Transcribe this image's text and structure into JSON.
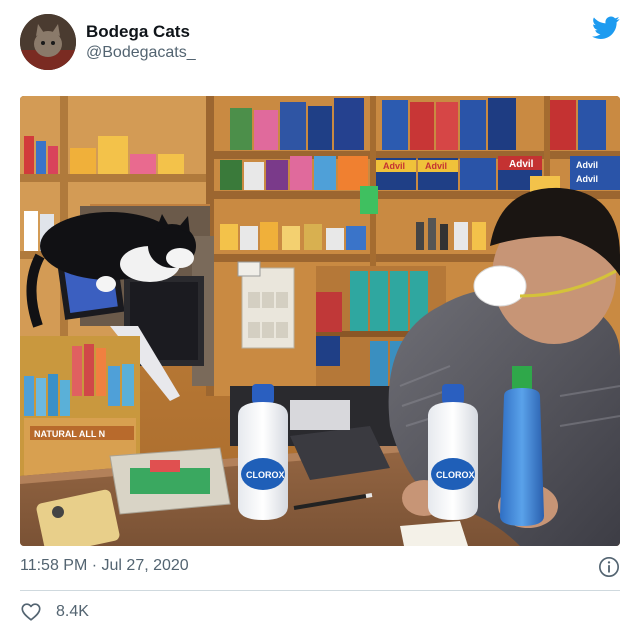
{
  "tweet": {
    "display_name": "Bodega Cats",
    "handle": "@Bodegacats_",
    "timestamp": "11:58 PM · Jul 27, 2020",
    "like_count": "8.4K"
  },
  "photo": {
    "bottle_label": "CLOROX",
    "box_label": "NATURAL ALL N",
    "shelf_brand_labels": [
      "Advil",
      "Advil",
      "Advil",
      "Advil",
      "Advil"
    ]
  },
  "colors": {
    "twitter_blue": "#1d9bf0",
    "secondary_text": "#536471",
    "divider": "#cfd9de"
  },
  "icons": [
    "twitter-bird-icon",
    "info-icon",
    "heart-icon"
  ]
}
